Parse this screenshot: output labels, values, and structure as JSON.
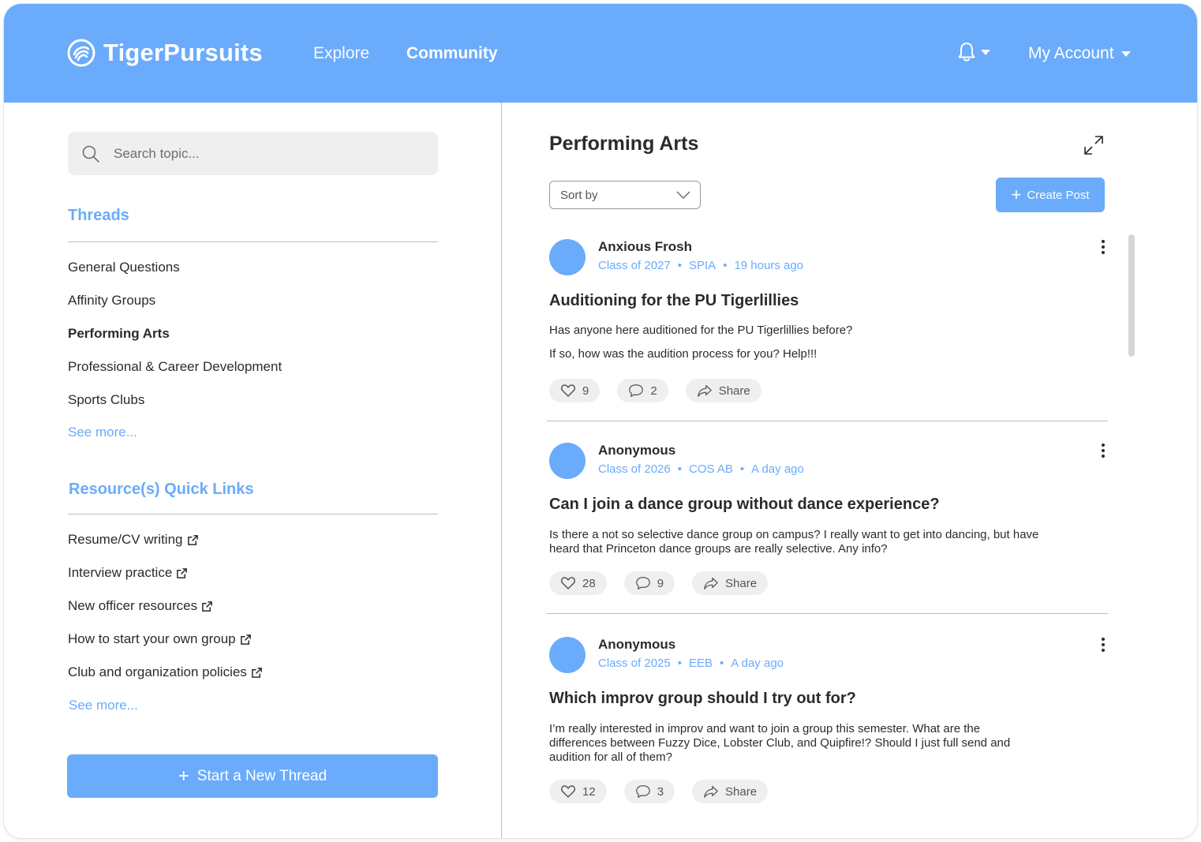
{
  "app": {
    "name": "TigerPursuits",
    "nav": [
      "Explore",
      "Community"
    ],
    "account_label": "My Account"
  },
  "search": {
    "placeholder": "Search topic..."
  },
  "threads": {
    "title": "Threads",
    "items": [
      "General Questions",
      "Affinity Groups",
      "Performing Arts",
      "Professional & Career Development",
      "Sports Clubs"
    ],
    "active": "Performing Arts",
    "see_more": "See more..."
  },
  "resources": {
    "title": "Resource(s) Quick Links",
    "items": [
      "Resume/CV writing",
      "Interview practice",
      "New officer resources",
      "How to start your own group",
      "Club and organization policies"
    ],
    "see_more": "See more..."
  },
  "new_thread_label": "Start a New Thread",
  "main": {
    "title": "Performing Arts",
    "sort_label": "Sort by",
    "create_post_label": "Create Post",
    "share_label": "Share",
    "posts": [
      {
        "author": "Anxious Frosh",
        "class_year": "Class of 2027",
        "dept": "SPIA",
        "time": "19 hours ago",
        "title": "Auditioning for the PU Tigerlillies",
        "body_1": "Has anyone here auditioned for the PU Tigerlillies before?",
        "body_2": "If so, how was the audition process for you? Help!!!",
        "likes": "9",
        "comments": "2"
      },
      {
        "author": "Anonymous",
        "class_year": "Class of 2026",
        "dept": "COS AB",
        "time": "A day ago",
        "title": "Can I join a dance group without dance experience?",
        "body_1": "Is there a not so selective dance group on campus? I really want to get into dancing, but have heard that Princeton dance groups are really selective. Any info?",
        "likes": "28",
        "comments": "9"
      },
      {
        "author": "Anonymous",
        "class_year": "Class of 2025",
        "dept": "EEB",
        "time": "A day ago",
        "title": "Which improv group should I try out for?",
        "body_1": "I’m really interested in improv and want to join a group this semester. What are the differences between Fuzzy Dice, Lobster Club, and Quipfire!? Should I just full send and audition for all of them?",
        "likes": "12",
        "comments": "3"
      }
    ]
  },
  "colors": {
    "accent": "#6aabfb",
    "text": "#2b2b2b",
    "pill_bg": "#efefef"
  }
}
